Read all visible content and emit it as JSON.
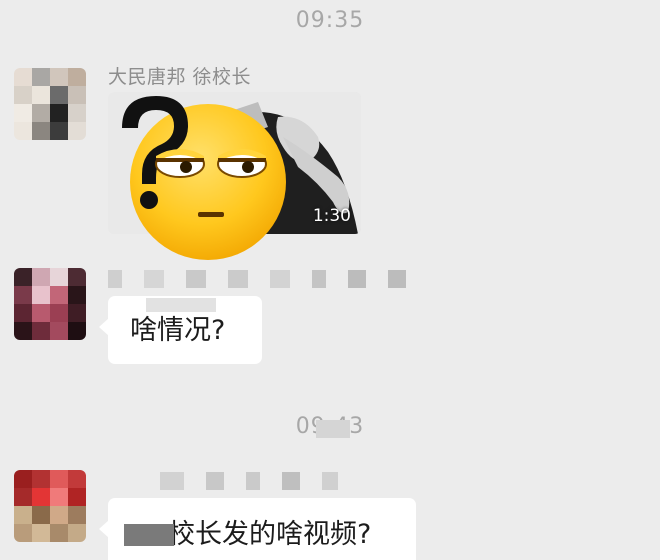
{
  "chat": {
    "timestamps": [
      "09:35",
      "09:43"
    ],
    "messages": [
      {
        "sender_name": "大民唐邦 徐校长",
        "type": "video",
        "duration": "1:30",
        "watermark": "",
        "overlay": "question-mark-unamused-emoji"
      },
      {
        "sender_name": "",
        "type": "text",
        "text": "啥情况?"
      },
      {
        "sender_name": "",
        "type": "text",
        "text": "校长发的啥视频?"
      }
    ]
  }
}
